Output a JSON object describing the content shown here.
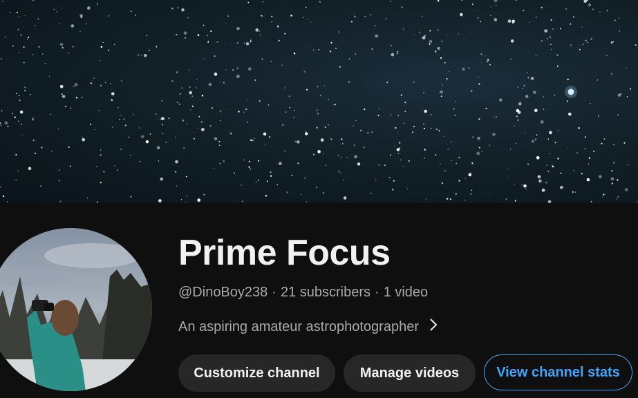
{
  "banner": {
    "alt": "starfield banner"
  },
  "channel": {
    "name": "Prime Focus",
    "handle": "@DinoBoy238",
    "subscribers": "21 subscribers",
    "videos": "1 video",
    "separator": "·",
    "description": "An aspiring amateur astrophotographer"
  },
  "buttons": {
    "customize": "Customize channel",
    "manage": "Manage videos",
    "stats": "View channel stats"
  },
  "colors": {
    "background": "#0f0f0f",
    "accent": "#3ea6ff",
    "button_bg": "#272727",
    "text_primary": "#f1f1f1",
    "text_secondary": "#aaaaaa"
  },
  "icons": {
    "description_more": "chevron-right-icon"
  }
}
